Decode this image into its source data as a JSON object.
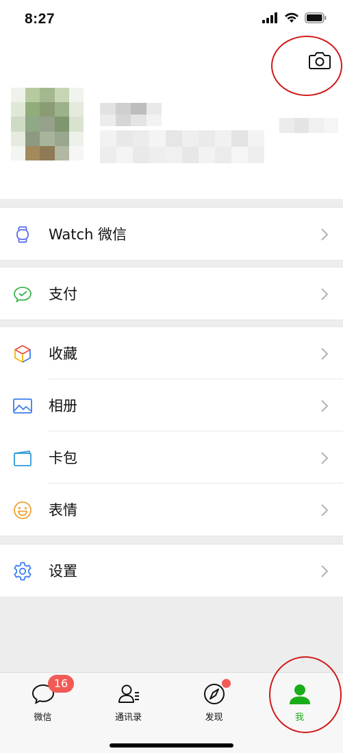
{
  "status_bar": {
    "time": "8:27"
  },
  "profile": {
    "camera_icon": "camera-icon"
  },
  "menu": {
    "watch": {
      "label": "Watch 微信",
      "icon": "watch-icon"
    },
    "pay": {
      "label": "支付",
      "icon": "pay-icon"
    },
    "favorites": {
      "label": "收藏",
      "icon": "favorites-icon"
    },
    "album": {
      "label": "相册",
      "icon": "album-icon"
    },
    "cards": {
      "label": "卡包",
      "icon": "card-icon"
    },
    "stickers": {
      "label": "表情",
      "icon": "emoji-icon"
    },
    "settings": {
      "label": "设置",
      "icon": "gear-icon"
    }
  },
  "tabs": [
    {
      "label": "微信",
      "badge": "16",
      "icon": "chat-icon"
    },
    {
      "label": "通讯录",
      "icon": "contacts-icon"
    },
    {
      "label": "发现",
      "icon": "compass-icon",
      "dot": true
    },
    {
      "label": "我",
      "icon": "person-icon",
      "active": true
    }
  ],
  "colors": {
    "accent_green": "#1aad19",
    "badge_red": "#f25a55",
    "annotation_red": "#d01818"
  }
}
